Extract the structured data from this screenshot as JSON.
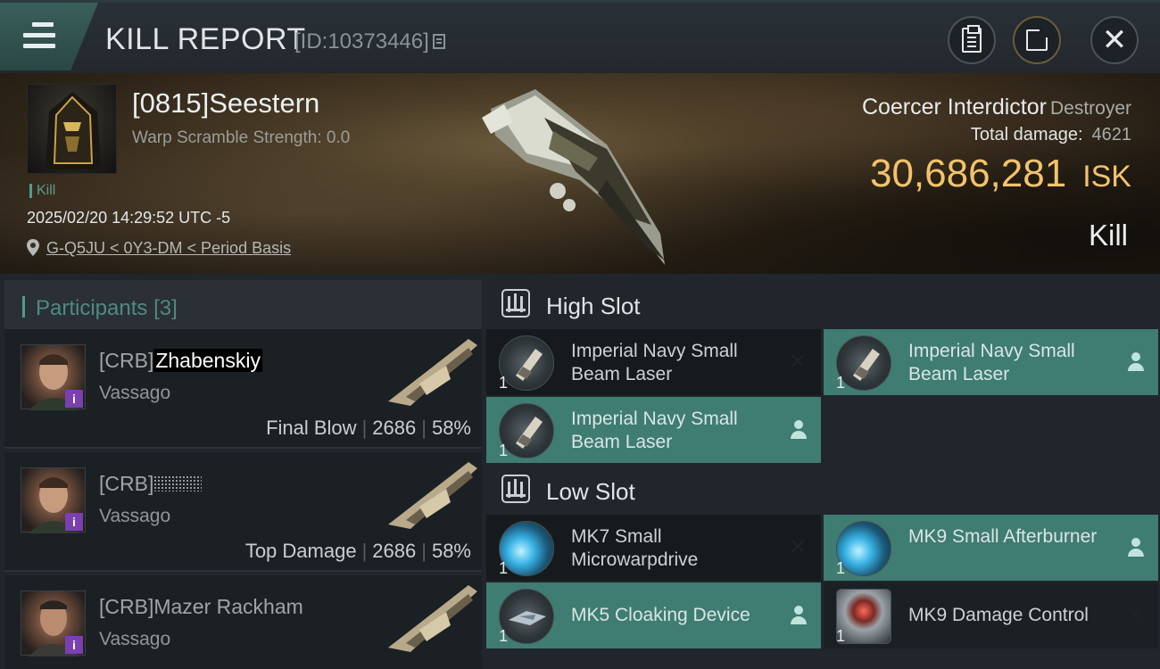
{
  "header": {
    "title": "KILL REPORT",
    "report_id": "[ID:10373446]"
  },
  "victim": {
    "name": "[0815]Seestern",
    "warp_scramble": "Warp Scramble Strength: 0.0",
    "tag": "Kill",
    "timestamp": "2025/02/20 14:29:52 UTC -5",
    "location": "G-Q5JU < 0Y3-DM < Period Basis",
    "ship_name": "Coercer Interdictor",
    "ship_class": "Destroyer",
    "total_damage_label": "Total damage:",
    "total_damage": "4621",
    "isk_value": "30,686,281",
    "isk_unit": "ISK",
    "result": "Kill"
  },
  "participants": {
    "title": "Participants",
    "count": "[3]",
    "rows": [
      {
        "corp": "[CRB]",
        "name": "Zhabenskiy",
        "ship": "Vassago",
        "role": "Final Blow",
        "damage": "2686",
        "percent": "58%"
      },
      {
        "corp": "[CRB]",
        "name": "",
        "ship": "Vassago",
        "role": "Top Damage",
        "damage": "2686",
        "percent": "58%"
      },
      {
        "corp": "[CRB]",
        "name": "Mazer Rackham",
        "ship": "Vassago",
        "role": "",
        "damage": "",
        "percent": ""
      }
    ]
  },
  "fitting": {
    "high_slot_title": "High Slot",
    "low_slot_title": "Low Slot",
    "high_slot": [
      {
        "name": "Imperial Navy Small Beam Laser",
        "qty": "1",
        "state": "destroyed",
        "icon": "beam-laser-icon"
      },
      {
        "name": "Imperial Navy Small Beam Laser",
        "qty": "1",
        "state": "dropped",
        "icon": "beam-laser-icon"
      },
      {
        "name": "Imperial Navy Small Beam Laser",
        "qty": "1",
        "state": "dropped",
        "icon": "beam-laser-icon"
      }
    ],
    "low_slot": [
      {
        "name": "MK7 Small Microwarpdrive",
        "qty": "1",
        "state": "destroyed",
        "icon": "microwarpdrive-icon"
      },
      {
        "name": "MK9 Small Afterburner",
        "qty": "1",
        "state": "dropped",
        "icon": "afterburner-icon"
      },
      {
        "name": "MK5 Cloaking Device",
        "qty": "1",
        "state": "dropped",
        "icon": "cloaking-device-icon"
      },
      {
        "name": "MK9 Damage Control",
        "qty": "1",
        "state": "destroyed",
        "icon": "damage-control-icon"
      }
    ]
  },
  "colors": {
    "accent_teal": "#4f9c8e",
    "dropped_bg": "#3f7c72",
    "isk_gold": "#f2c36b",
    "corp_badge": "#7a3fb0"
  }
}
